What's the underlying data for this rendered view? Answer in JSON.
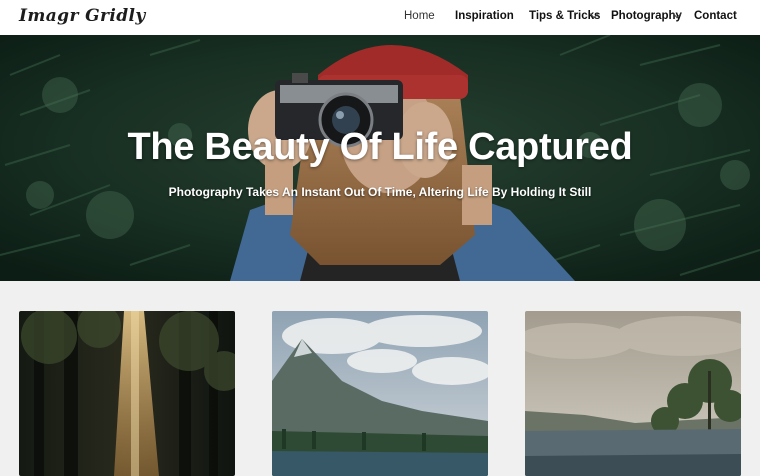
{
  "site": {
    "logo_text": "Imagr Gridly"
  },
  "nav": {
    "items": [
      {
        "label": "Home"
      },
      {
        "label": "Inspiration"
      },
      {
        "label": "Tips & Tricks"
      },
      {
        "label": "Photography"
      },
      {
        "label": "Contact"
      }
    ]
  },
  "hero": {
    "title": "The Beauty Of Life Captured",
    "subtitle": "Photography Takes An Instant Out Of Time, Altering Life By Holding It Still"
  },
  "cards": [
    {
      "image": "forest-light-photo"
    },
    {
      "image": "mountain-lake-photo"
    },
    {
      "image": "river-trees-photo"
    }
  ]
}
